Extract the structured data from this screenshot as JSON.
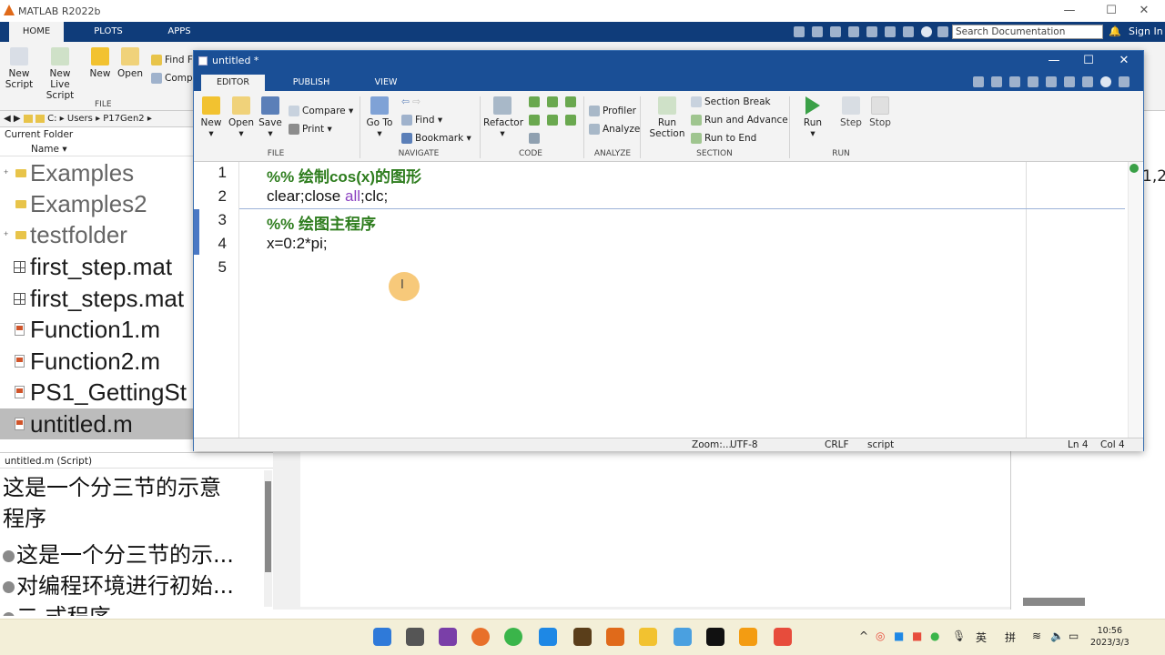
{
  "app": {
    "title": "MATLAB R2022b"
  },
  "main_tabs": [
    "HOME",
    "PLOTS",
    "APPS"
  ],
  "search": {
    "placeholder": "Search Documentation"
  },
  "sign_in": "Sign In",
  "home_toolstrip": {
    "new_script": "New\nScript",
    "new_live_script": "New\nLive Script",
    "new": "New",
    "open": "Open",
    "find_files": "Find Fi",
    "compare": "Compa",
    "section_file": "FILE"
  },
  "address": {
    "path": [
      "C:",
      "Users",
      "P17Gen2"
    ]
  },
  "current_folder": {
    "title": "Current Folder",
    "name_header": "Name",
    "items": [
      {
        "name": "Examples",
        "kind": "folder"
      },
      {
        "name": "Examples2",
        "kind": "folder"
      },
      {
        "name": "testfolder",
        "kind": "folder"
      },
      {
        "name": "first_step.mat",
        "kind": "mat"
      },
      {
        "name": "first_steps.mat",
        "kind": "mat"
      },
      {
        "name": "Function1.m",
        "kind": "m"
      },
      {
        "name": "Function2.m",
        "kind": "m"
      },
      {
        "name": "PS1_GettingSt",
        "kind": "m"
      },
      {
        "name": "untitled.m",
        "kind": "m",
        "selected": true
      }
    ]
  },
  "details": {
    "header": "untitled.m  (Script)",
    "description": "这是一个分三节的示意",
    "description2": "程序",
    "sections": [
      "这是一个分三节的示...",
      "对编程环境进行初始...",
      "二 式程序"
    ]
  },
  "editor": {
    "title": "untitled *",
    "tabs": [
      "EDITOR",
      "PUBLISH",
      "VIEW"
    ],
    "toolstrip": {
      "new": "New",
      "open": "Open",
      "save": "Save",
      "compare": "Compare",
      "print": "Print",
      "go_to": "Go To",
      "find": "Find",
      "bookmark": "Bookmark",
      "refactor": "Refactor",
      "profiler": "Profiler",
      "analyze": "Analyze",
      "run_section": "Run\nSection",
      "section_break": "Section Break",
      "run_and_advance": "Run and Advance",
      "run_to_end": "Run to End",
      "run": "Run",
      "step": "Step",
      "stop": "Stop",
      "sections": [
        "FILE",
        "NAVIGATE",
        "CODE",
        "ANALYZE",
        "SECTION",
        "RUN"
      ]
    },
    "lines": [
      {
        "n": "1",
        "text": "%% 绘制cos(x)的图形"
      },
      {
        "n": "2",
        "text_a": "clear;close ",
        "text_kw": "all",
        "text_b": ";clc;"
      },
      {
        "n": "3",
        "text": "%% 绘图主程序"
      },
      {
        "n": "4",
        "text": "x=0:2*pi;"
      },
      {
        "n": "5",
        "text": ""
      }
    ],
    "status": {
      "zoom": "Zoom:...",
      "encoding": "UTF-8",
      "eol": "CRLF",
      "type": "script",
      "ln": "Ln  4",
      "col": "Col  4"
    }
  },
  "right_panel": {
    "fragment": "1,2"
  },
  "taskbar": {
    "ime_lang": "英",
    "ime_mode": "拼",
    "time": "10:56",
    "date": "2023/3/3"
  },
  "colors": {
    "title_blue": "#0f3c7a",
    "editor_blue": "#1a4f96",
    "comment_green": "#2e7d1e",
    "keyword_purple": "#8a3fc0"
  }
}
